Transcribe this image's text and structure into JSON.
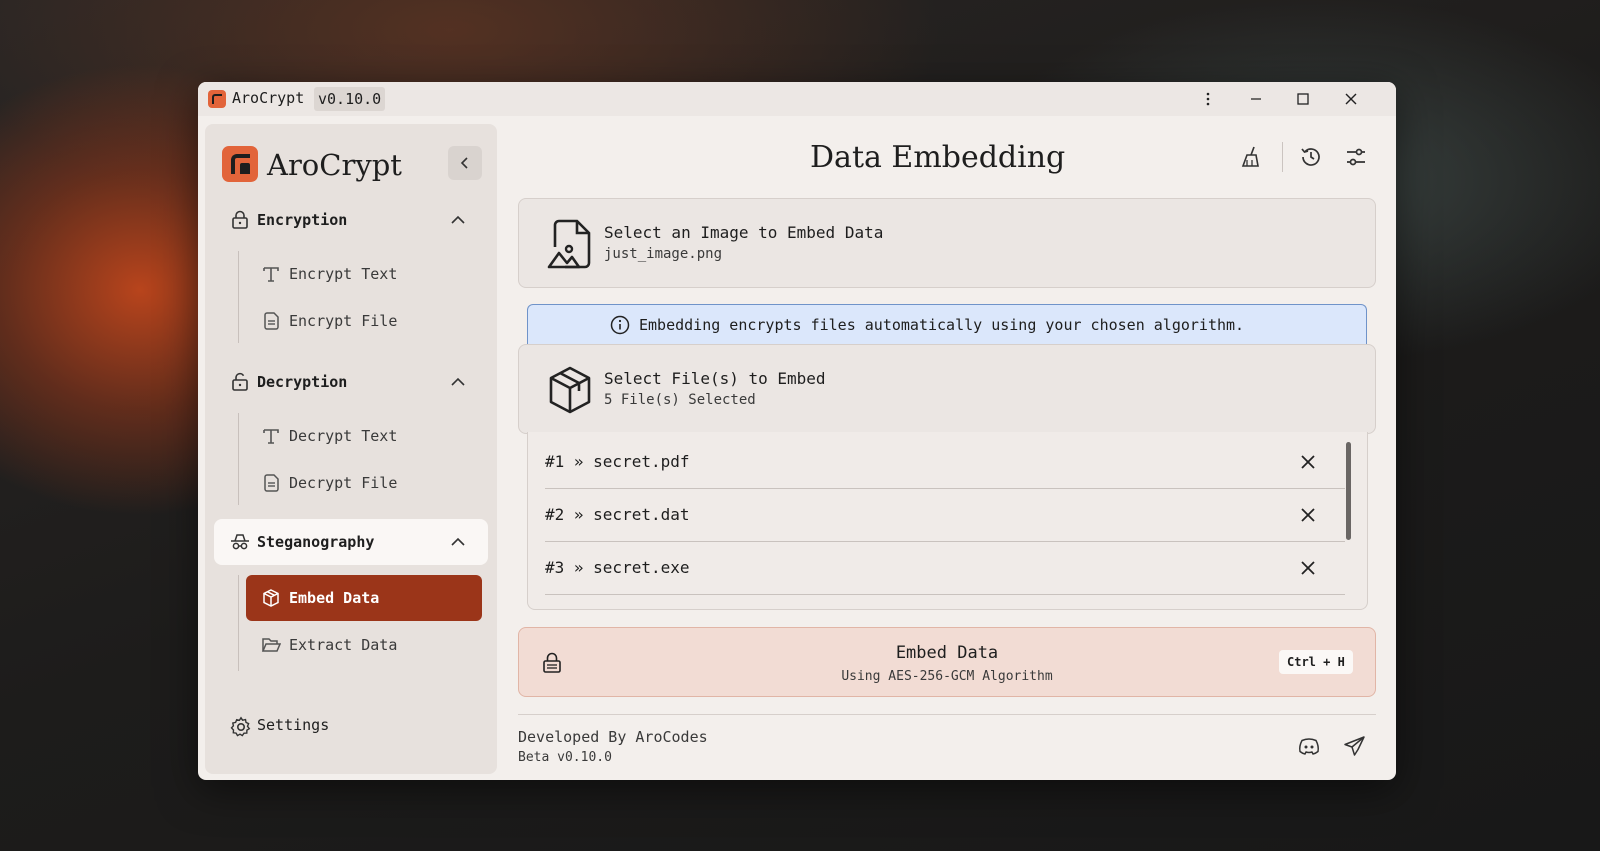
{
  "window": {
    "title": "AroCrypt",
    "version_badge": "v0.10.0"
  },
  "sidebar": {
    "brand": "AroCrypt",
    "sections": [
      {
        "label": "Encryption",
        "icon": "lock-icon",
        "items": [
          {
            "label": "Encrypt Text",
            "icon": "text-icon"
          },
          {
            "label": "Encrypt File",
            "icon": "file-icon"
          }
        ]
      },
      {
        "label": "Decryption",
        "icon": "unlock-icon",
        "items": [
          {
            "label": "Decrypt Text",
            "icon": "text-icon"
          },
          {
            "label": "Decrypt File",
            "icon": "file-icon"
          }
        ]
      },
      {
        "label": "Steganography",
        "icon": "spy-icon",
        "items": [
          {
            "label": "Embed Data",
            "icon": "package-icon",
            "active": true
          },
          {
            "label": "Extract Data",
            "icon": "folder-open-icon"
          }
        ]
      }
    ],
    "settings_label": "Settings"
  },
  "main": {
    "title": "Data Embedding",
    "image_card": {
      "title": "Select an Image to Embed Data",
      "subtitle": "just_image.png"
    },
    "info_banner": "Embedding encrypts files automatically using your chosen algorithm.",
    "files_card": {
      "title": "Select File(s) to Embed",
      "subtitle": "5 File(s) Selected"
    },
    "files": [
      "#1 » secret.pdf",
      "#2 » secret.dat",
      "#3 » secret.exe"
    ],
    "embed_button": {
      "label": "Embed Data",
      "subtitle": "Using AES-256-GCM Algorithm",
      "shortcut": "Ctrl + H"
    }
  },
  "footer": {
    "developer": "Developed By AroCodes",
    "version": "Beta v0.10.0"
  },
  "colors": {
    "accent": "#e2643a",
    "active_nav": "#9b3519",
    "info_bg": "#dbe7fb",
    "embed_bg": "#f2dcd4"
  }
}
